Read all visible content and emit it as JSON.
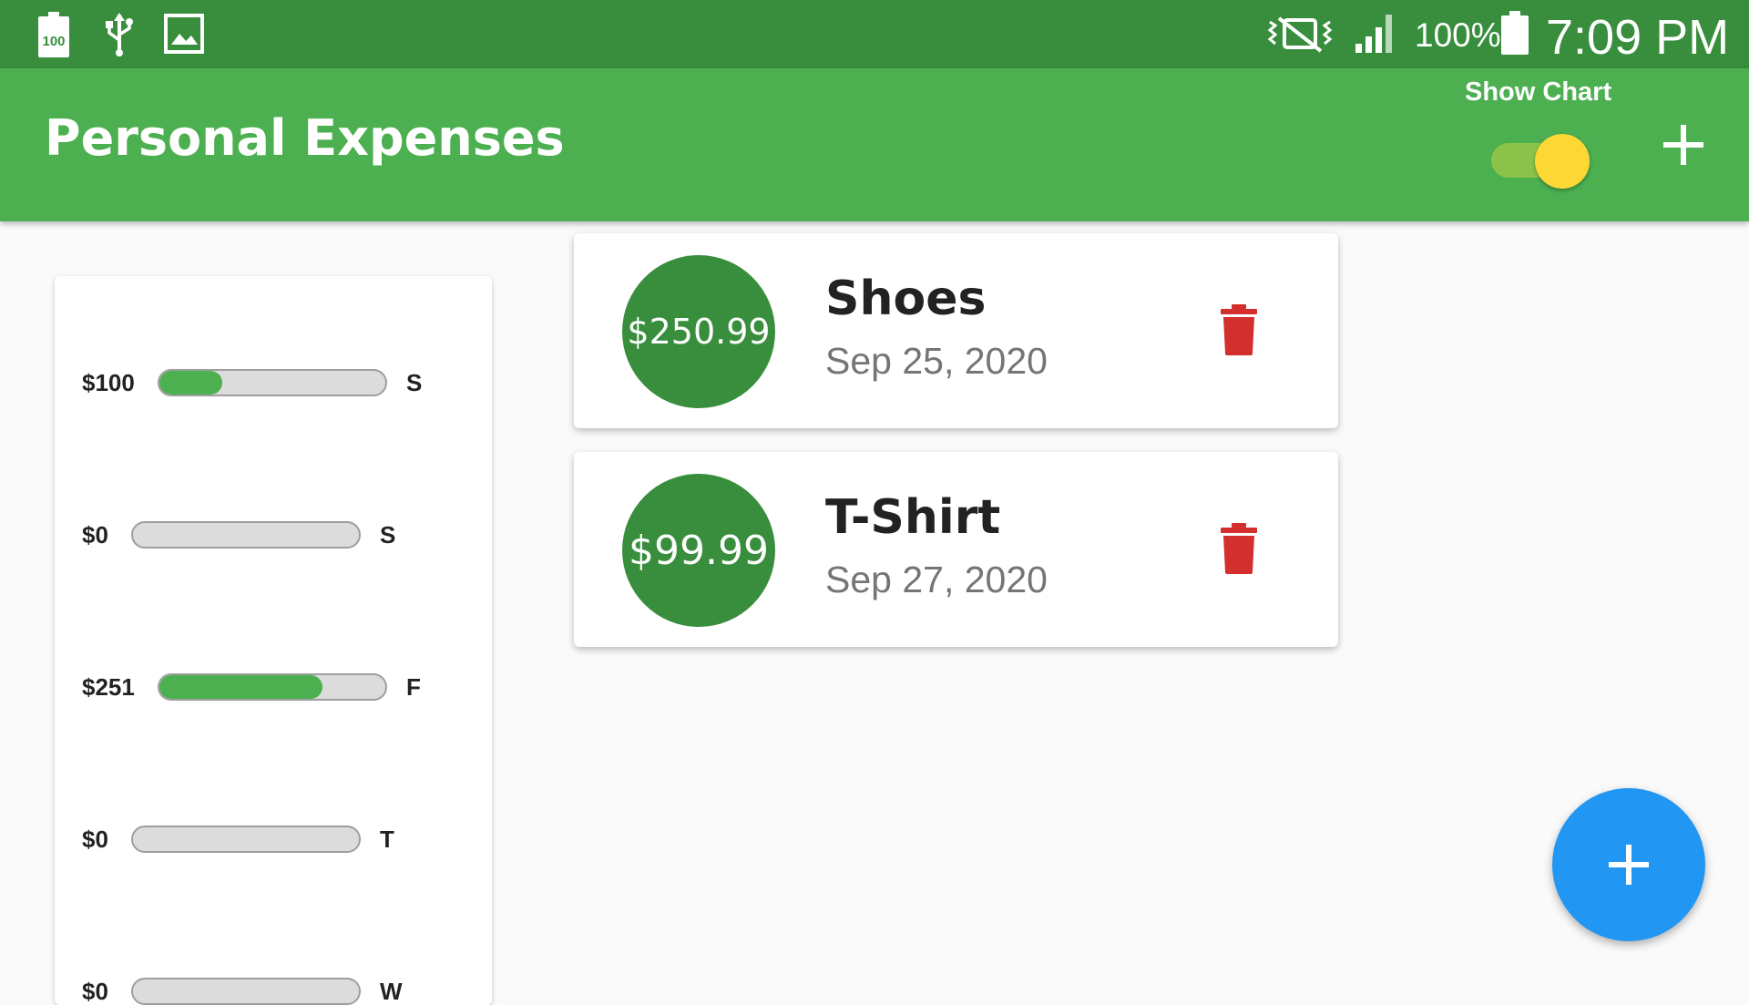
{
  "status_bar": {
    "battery_saver_badge": "100",
    "battery_percent": "100%",
    "time": "7:09 PM",
    "icons": [
      "battery-100-icon",
      "usb-icon",
      "image-icon",
      "vibrate-off-icon",
      "signal-icon",
      "battery-icon"
    ]
  },
  "app_bar": {
    "title": "Personal Expenses",
    "show_chart_label": "Show Chart",
    "show_chart_on": true,
    "add_icon": "plus-icon"
  },
  "chart": {
    "bars": [
      {
        "amount": "$100",
        "day": "S",
        "fill_percent": 28
      },
      {
        "amount": "$0",
        "day": "S",
        "fill_percent": 0
      },
      {
        "amount": "$251",
        "day": "F",
        "fill_percent": 72
      },
      {
        "amount": "$0",
        "day": "T",
        "fill_percent": 0
      },
      {
        "amount": "$0",
        "day": "W",
        "fill_percent": 0
      }
    ]
  },
  "transactions": [
    {
      "amount": "$250.99",
      "title": "Shoes",
      "date": "Sep 25, 2020",
      "delete_icon": "trash-icon"
    },
    {
      "amount": "$99.99",
      "title": "T-Shirt",
      "date": "Sep 27, 2020",
      "delete_icon": "trash-icon"
    }
  ],
  "fab": {
    "icon": "plus-icon"
  },
  "colors": {
    "status_bar": "#388e3c",
    "app_bar": "#4caf50",
    "accent_yellow": "#fdd835",
    "bar_fill": "#4caf50",
    "avatar": "#388e3c",
    "delete": "#d32f2f",
    "fab": "#2196f3"
  }
}
